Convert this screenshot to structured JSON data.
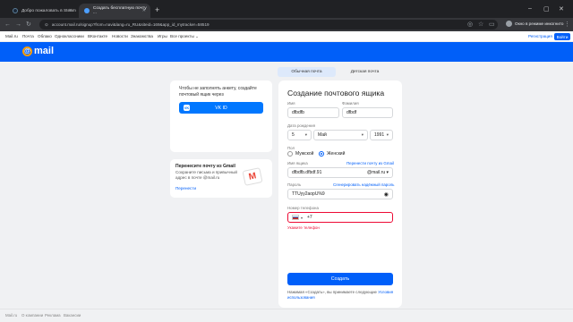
{
  "browser": {
    "tabs": [
      {
        "title": "Добро пожаловать в Steam",
        "favicon_color": "#1b2838"
      },
      {
        "title": "Создать бесплатную почту ...",
        "favicon_color": "#4d9fff"
      }
    ],
    "new_tab": "+",
    "url": "account.mail.ru/signup?from=navi&lang=ru_RU&siteid=169&app_id_mytracker=58519",
    "incognito": "Окно в режиме инкогнито"
  },
  "portal": {
    "links": [
      "Mail.ru",
      "Почта",
      "Облако",
      "Одноклассники",
      "ВКонтакте",
      "Новости",
      "Знакомства",
      "Игры",
      "Все проекты ⌄"
    ],
    "register": "Регистрация",
    "login": "Войти"
  },
  "header": {
    "logo": "mail"
  },
  "segment": {
    "tabs": [
      "Обычная почта",
      "Детская почта"
    ],
    "active": 0
  },
  "vk_card": {
    "text": "Чтобы не заполнять анкету, создайте почтовый ящик через",
    "button": "VK ID",
    "vk_logo": "VK"
  },
  "gmail_card": {
    "title": "Перенесите почту из Gmail",
    "text": "Сохраните письма и привычный адрес в почте @mail.ru",
    "link": "Перенести",
    "icon": "M"
  },
  "form": {
    "title": "Создание почтового ящика",
    "first_name_label": "Имя",
    "first_name_value": "dfbdfb",
    "last_name_label": "Фамилия",
    "last_name_value": "dfbdf",
    "birthdate_label": "Дата рождения",
    "day": "5",
    "month": "Май",
    "year": "1991",
    "gender_label": "Пол",
    "gender_male": "Мужской",
    "gender_female": "Женский",
    "mailbox_label": "Имя ящика",
    "transfer_link": "Перенести почту из Gmail",
    "mailbox_value": "dfbdfb.dfbdf.91",
    "domain": "@mail.ru",
    "password_label": "Пароль",
    "generate_link": "Сгенерировать надёжный пароль",
    "password_value": "TTUyy2aopU%9",
    "phone_label": "Номер телефона",
    "phone_value": "+7",
    "phone_error": "Укажите телефон",
    "submit": "Создать",
    "terms_prefix": "Нажимая «Создать», вы принимаете следующие",
    "terms_link": "Условия использования"
  },
  "footer": {
    "links": [
      "Mail.ru",
      "О компании",
      "Реклама",
      "Вакансии"
    ]
  },
  "colors": {
    "brand": "#005ff9",
    "vk": "#0077ff",
    "error": "#ed0a34"
  }
}
